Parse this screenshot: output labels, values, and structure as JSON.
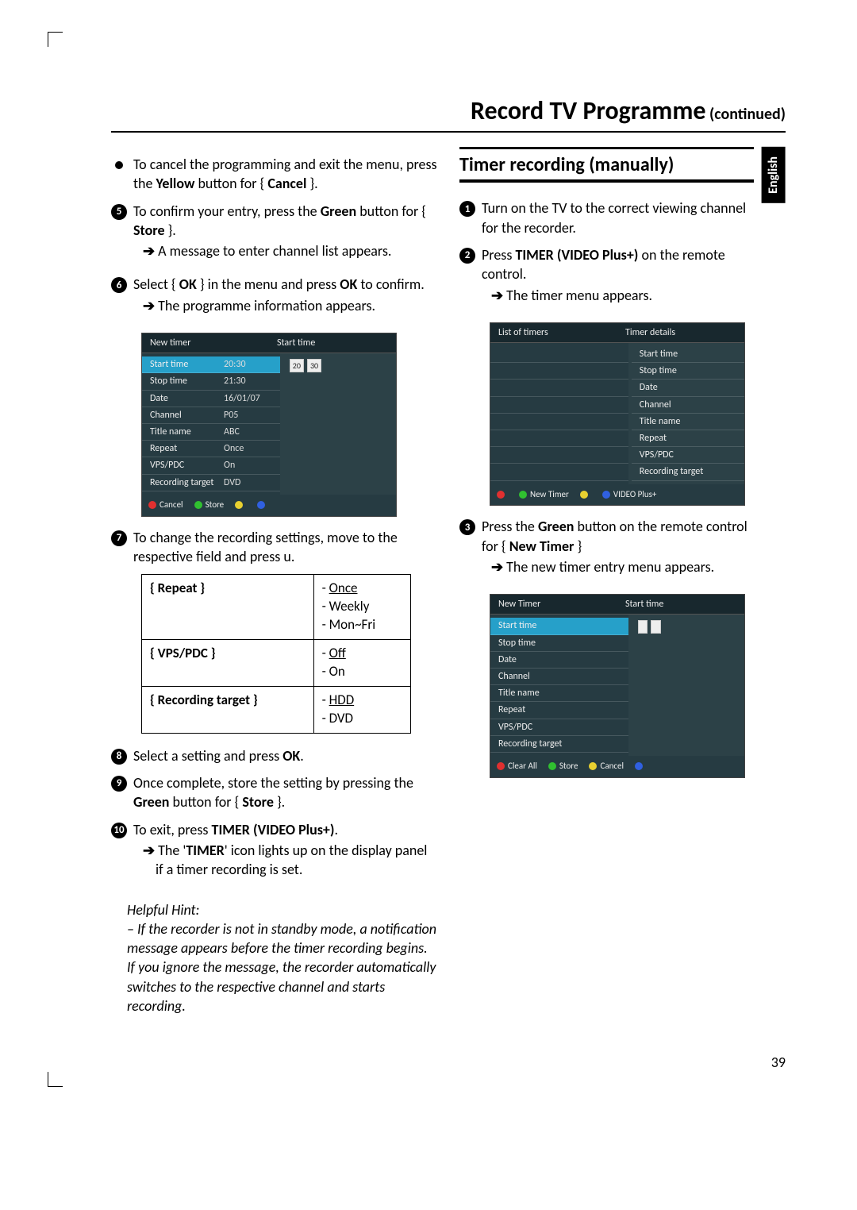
{
  "header": {
    "title": "Record TV Programme",
    "continued": " (continued)"
  },
  "language_tab": "English",
  "page_number": "39",
  "left": {
    "bullet1_a": "To cancel the programming and exit the menu, press the ",
    "bullet1_b": "Yellow",
    "bullet1_c": " button for { ",
    "bullet1_d": "Cancel",
    "bullet1_e": " }.",
    "s5_a": "To confirm your entry, press the ",
    "s5_b": "Green",
    "s5_c": " button for { ",
    "s5_d": "Store",
    "s5_e": " }.",
    "s5_arrow": "A message to enter channel list appears.",
    "s6_a": "Select { ",
    "s6_b": "OK",
    "s6_c": " } in the menu and press ",
    "s6_d": "OK",
    "s6_e": " to confirm.",
    "s6_arrow": "The programme information appears.",
    "s7": "To change the recording settings, move to the respective field and press u.",
    "opts": {
      "repeat_label": "{ Repeat }",
      "repeat_vals": [
        "Once",
        "Weekly",
        "Mon~Fri"
      ],
      "vps_label": "{ VPS/PDC }",
      "vps_vals": [
        "Off",
        "On"
      ],
      "rec_label": "{ Recording target }",
      "rec_vals": [
        "HDD",
        "DVD"
      ]
    },
    "s8_a": "Select a setting and press ",
    "s8_b": "OK",
    "s8_c": ".",
    "s9_a": "Once complete, store the setting by pressing the ",
    "s9_b": "Green",
    "s9_c": " button for { ",
    "s9_d": "Store",
    "s9_e": " }.",
    "s10_a": "To exit, press ",
    "s10_b": "TIMER (VIDEO Plus+)",
    "s10_c": ".",
    "s10_arrow_a": "The '",
    "s10_arrow_b": "TIMER",
    "s10_arrow_c": "' icon lights up on the display panel if a timer recording is set.",
    "hint_head": "Helpful Hint:",
    "hint_body": "– If the recorder is not in standby mode, a notification message appears before the timer recording begins.  If you ignore the message, the recorder automatically switches to the respective channel and starts recording."
  },
  "right": {
    "section": "Timer recording (manually)",
    "s1": "Turn on the TV to the correct viewing channel for the recorder.",
    "s2_a": "Press ",
    "s2_b": "TIMER (VIDEO Plus+)",
    "s2_c": " on the remote control.",
    "s2_arrow": "The timer menu appears.",
    "s3_a": "Press the ",
    "s3_b": "Green",
    "s3_c": " button on the remote control for { ",
    "s3_d": "New Timer",
    "s3_e": " }",
    "s3_arrow": "The new timer entry menu appears."
  },
  "osd1": {
    "head_left": "New timer",
    "head_right": "Start time",
    "rows": [
      {
        "lbl": "Start time",
        "val": "20:30"
      },
      {
        "lbl": "Stop time",
        "val": "21:30"
      },
      {
        "lbl": "Date",
        "val": "16/01/07"
      },
      {
        "lbl": "Channel",
        "val": "P05"
      },
      {
        "lbl": "Title name",
        "val": "ABC"
      },
      {
        "lbl": "Repeat",
        "val": "Once"
      },
      {
        "lbl": "VPS/PDC",
        "val": "On"
      },
      {
        "lbl": "Recording target",
        "val": "DVD"
      }
    ],
    "right_boxes": [
      "20",
      "30"
    ],
    "foot": {
      "red": "Cancel",
      "green": "Store"
    }
  },
  "osd2": {
    "head_left": "List of timers",
    "head_right": "Timer details",
    "right_labels": [
      "Start time",
      "Stop time",
      "Date",
      "Channel",
      "Title name",
      "Repeat",
      "VPS/PDC",
      "Recording target"
    ],
    "foot": {
      "green": "New Timer",
      "blue": "VIDEO Plus+"
    }
  },
  "osd3": {
    "head_left": "New Timer",
    "head_right": "Start time",
    "rows": [
      "Start time",
      "Stop time",
      "Date",
      "Channel",
      "Title name",
      "Repeat",
      "VPS/PDC",
      "Recording target"
    ],
    "foot": {
      "red": "Clear All",
      "green": "Store",
      "yellow": "Cancel"
    }
  }
}
